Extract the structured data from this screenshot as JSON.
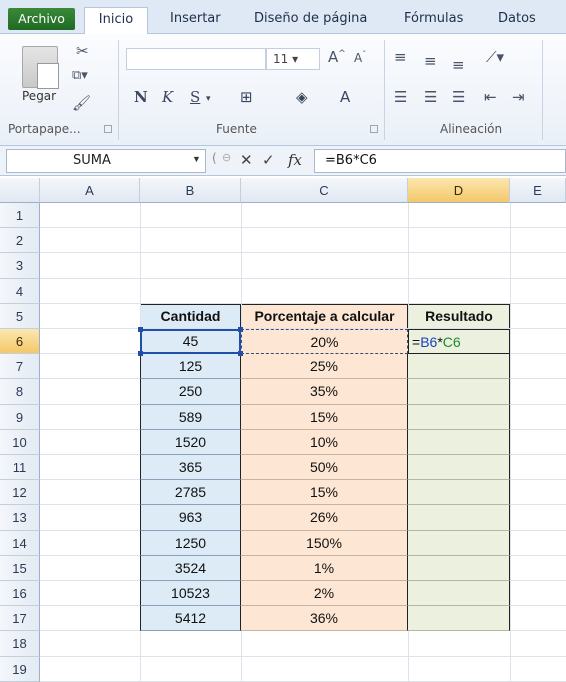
{
  "ribbon": {
    "tabs": [
      "Archivo",
      "Inicio",
      "Insertar",
      "Diseño de página",
      "Fórmulas",
      "Datos"
    ],
    "groups": {
      "clipboard": {
        "label": "Portapape...",
        "paste_label": "Pegar"
      },
      "font": {
        "label": "Fuente",
        "size": "11"
      },
      "alignment": {
        "label": "Alineación"
      }
    }
  },
  "formula_bar": {
    "name_box": "SUMA",
    "formula": "=B6*C6"
  },
  "sheet": {
    "columns": [
      "A",
      "B",
      "C",
      "D"
    ],
    "extra_col": "E",
    "rows": [
      "1",
      "2",
      "3",
      "4",
      "5",
      "6",
      "7",
      "8",
      "9",
      "10",
      "11",
      "12",
      "13",
      "14",
      "15",
      "16",
      "17",
      "18",
      "19"
    ],
    "headers": {
      "cantidad": "Cantidad",
      "porcentaje": "Porcentaje a calcular",
      "resultado": "Resultado"
    },
    "active_formula": {
      "prefix": "=",
      "ref_b": "B6",
      "op": "*",
      "ref_c": "C6"
    },
    "data": [
      {
        "cantidad": "45",
        "porcentaje": "20%"
      },
      {
        "cantidad": "125",
        "porcentaje": "25%"
      },
      {
        "cantidad": "250",
        "porcentaje": "35%"
      },
      {
        "cantidad": "589",
        "porcentaje": "15%"
      },
      {
        "cantidad": "1520",
        "porcentaje": "10%"
      },
      {
        "cantidad": "365",
        "porcentaje": "50%"
      },
      {
        "cantidad": "2785",
        "porcentaje": "15%"
      },
      {
        "cantidad": "963",
        "porcentaje": "26%"
      },
      {
        "cantidad": "1250",
        "porcentaje": "150%"
      },
      {
        "cantidad": "3524",
        "porcentaje": "1%"
      },
      {
        "cantidad": "10523",
        "porcentaje": "2%"
      },
      {
        "cantidad": "5412",
        "porcentaje": "36%"
      }
    ]
  },
  "colors": {
    "cantidad_fill": "#dcebf6",
    "porcentaje_fill": "#fde6d3",
    "resultado_fill": "#ebf1de",
    "active_header": "#f4c86a"
  }
}
